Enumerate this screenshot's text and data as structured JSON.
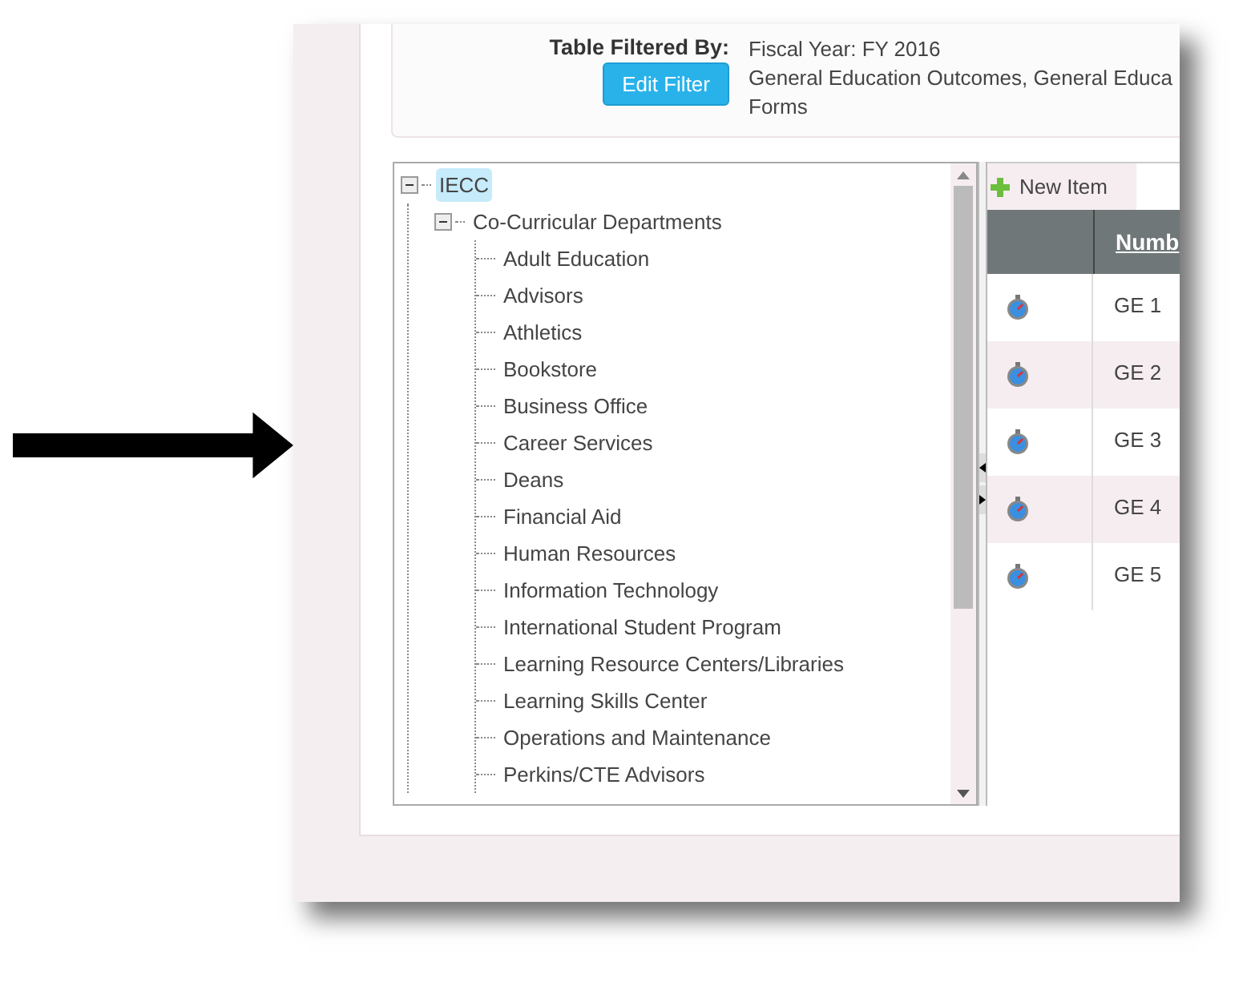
{
  "filter": {
    "label": "Table Filtered By:",
    "button": "Edit Filter",
    "lines": [
      "Fiscal Year: FY 2016",
      "General Education Outcomes, General Educa",
      "Forms"
    ]
  },
  "tree": {
    "label": "IECC",
    "expanded": true,
    "selected": true,
    "children": [
      {
        "label": "Co-Curricular Departments",
        "expanded": true,
        "selected": false,
        "children": [
          {
            "label": "Adult Education",
            "selected": false
          },
          {
            "label": "Advisors",
            "selected": false
          },
          {
            "label": "Athletics",
            "selected": false
          },
          {
            "label": "Bookstore",
            "selected": false
          },
          {
            "label": "Business Office",
            "selected": false
          },
          {
            "label": "Career Services",
            "selected": false
          },
          {
            "label": "Deans",
            "selected": false
          },
          {
            "label": "Financial Aid",
            "selected": false
          },
          {
            "label": "Human Resources",
            "selected": false
          },
          {
            "label": "Information Technology",
            "selected": false
          },
          {
            "label": "International Student Program",
            "selected": false
          },
          {
            "label": "Learning Resource Centers/Libraries",
            "selected": false
          },
          {
            "label": "Learning Skills Center",
            "selected": false
          },
          {
            "label": "Operations and Maintenance",
            "selected": false
          },
          {
            "label": "Perkins/CTE Advisors",
            "selected": false
          }
        ]
      }
    ]
  },
  "grid": {
    "toolbar": {
      "new_item": "New Item"
    },
    "columns": [
      "Numb"
    ],
    "rows": [
      {
        "number": "GE 1"
      },
      {
        "number": "GE 2"
      },
      {
        "number": "GE 3"
      },
      {
        "number": "GE 4"
      },
      {
        "number": "GE 5"
      }
    ]
  }
}
